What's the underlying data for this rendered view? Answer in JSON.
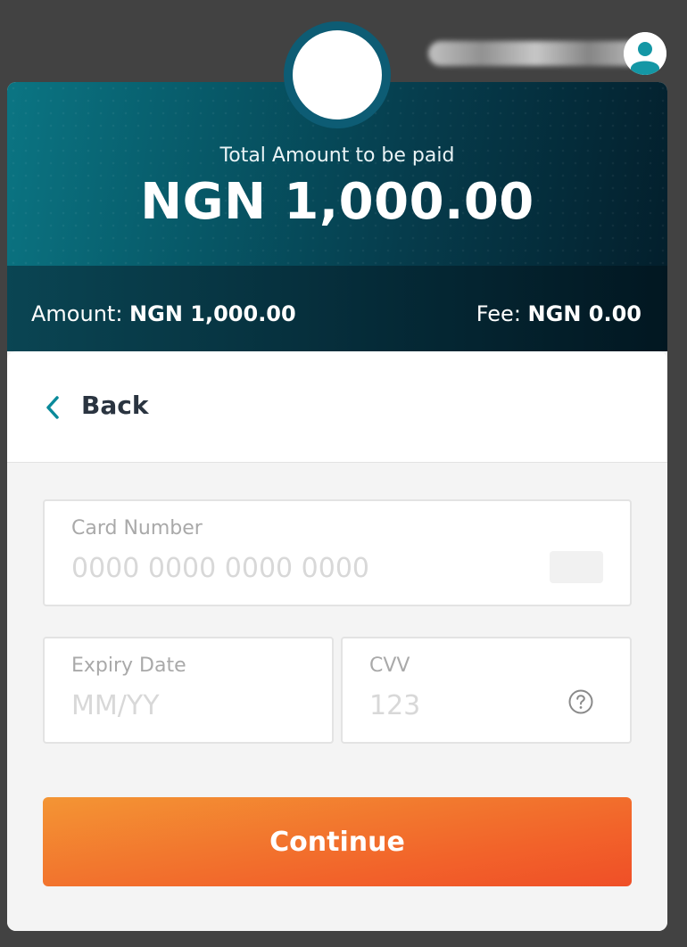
{
  "header": {
    "total_label": "Total Amount to be paid",
    "total_amount": "NGN 1,000.00"
  },
  "summary": {
    "amount_label": "Amount:",
    "amount_value": "NGN 1,000.00",
    "fee_label": "Fee:",
    "fee_value": "NGN 0.00"
  },
  "nav": {
    "back_label": "Back"
  },
  "form": {
    "card_number": {
      "label": "Card Number",
      "placeholder": "0000 0000 0000 0000",
      "value": ""
    },
    "expiry": {
      "label": "Expiry Date",
      "placeholder": "MM/YY",
      "value": ""
    },
    "cvv": {
      "label": "CVV",
      "placeholder": "123",
      "value": ""
    },
    "submit_label": "Continue"
  },
  "icons": {
    "back": "chevron-left-icon",
    "help": "question-circle-icon",
    "user": "user-avatar-icon",
    "card_brand": "card-brand-icon"
  },
  "colors": {
    "accent_teal": "#0a8a9a",
    "button_orange": "#f2622a",
    "header_dark": "#031f2c"
  }
}
